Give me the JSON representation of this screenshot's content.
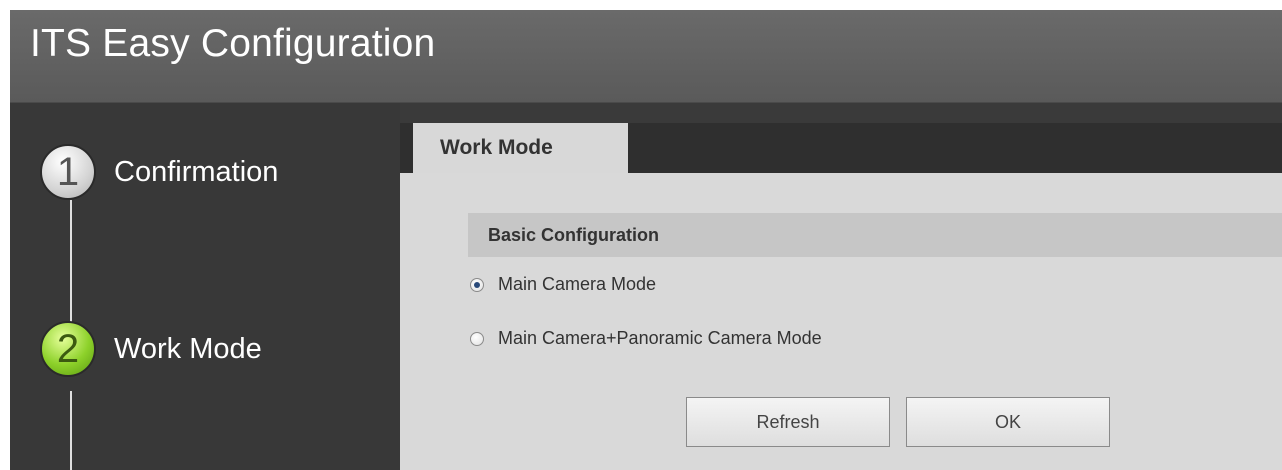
{
  "titlebar": {
    "title": "ITS Easy Configuration"
  },
  "steps": [
    {
      "number": "1",
      "label": "Confirmation",
      "state": "inactive"
    },
    {
      "number": "2",
      "label": "Work Mode",
      "state": "active"
    }
  ],
  "tabs": [
    {
      "label": "Work Mode"
    }
  ],
  "section": {
    "title": "Basic Configuration",
    "options": [
      {
        "label": "Main Camera Mode",
        "checked": true
      },
      {
        "label": "Main Camera+Panoramic Camera Mode",
        "checked": false
      }
    ]
  },
  "buttons": {
    "refresh": "Refresh",
    "ok": "OK"
  },
  "colors": {
    "active_step": "#8dd12a",
    "titlebar": "#5f5f5f",
    "panel": "#d9d9d9"
  }
}
